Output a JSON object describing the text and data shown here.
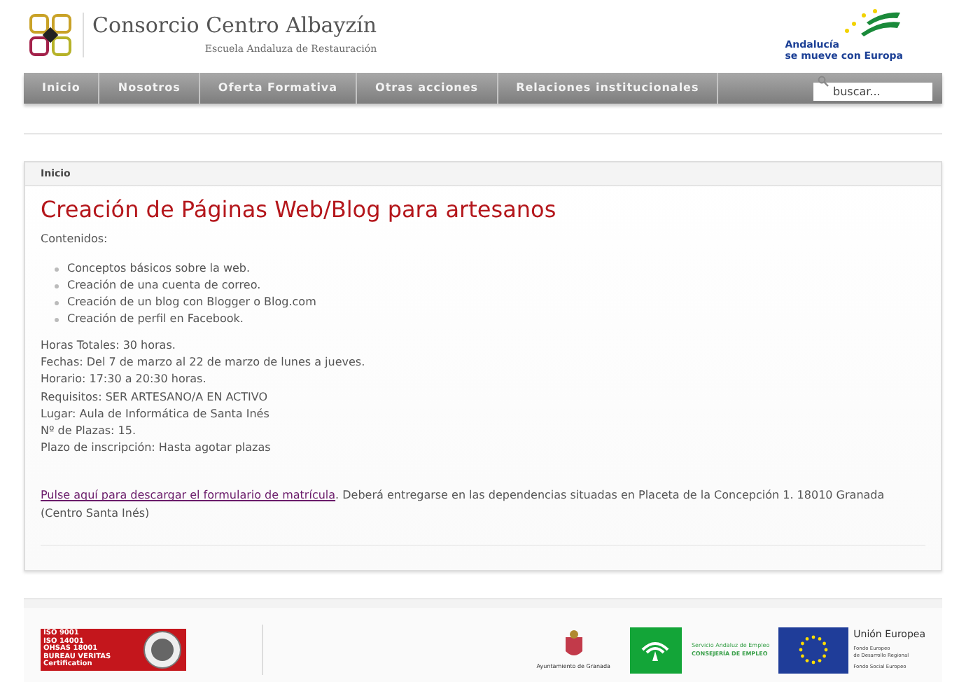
{
  "header": {
    "site_title": "Consorcio Centro Albayzín",
    "subtitle": "Escuela Andaluza de Restauración",
    "badge": {
      "line1": "Andalucía",
      "line2": "se mueve con Europa"
    }
  },
  "nav": {
    "items": [
      {
        "label": "Inicio"
      },
      {
        "label": "Nosotros"
      },
      {
        "label": "Oferta Formativa"
      },
      {
        "label": "Otras acciones"
      },
      {
        "label": "Relaciones institucionales"
      }
    ],
    "search": {
      "placeholder": "buscar..."
    }
  },
  "breadcrumb": "Inicio",
  "article": {
    "title": "Creación de Páginas Web/Blog para artesanos",
    "intro": "Contenidos:",
    "bullets": [
      "Conceptos básicos sobre la web.",
      "Creación de una cuenta de correo.",
      "Creación de un blog con Blogger o Blog.com",
      "Creación de perfil en Facebook."
    ],
    "details": [
      "Horas Totales: 30 horas.",
      "Fechas: Del 7 de marzo al 22 de marzo de lunes a jueves.",
      "Horario: 17:30 a 20:30 horas.",
      "Requisitos: SER ARTESANO/A EN ACTIVO",
      "Lugar: Aula de Informática de Santa Inés",
      "Nº de Plazas: 15.",
      "Plazo de inscripción: Hasta agotar plazas"
    ],
    "link": "Pulse aquí para descargar el formulario de matrícula",
    "after_link": ". Deberá entregarse en las dependencias situadas en Placeta de la Concepción 1. 18010 Granada (Centro Santa Inés)"
  },
  "footer": {
    "certification": [
      "ISO 9001",
      "ISO 14001",
      "OHSAS 18001",
      "BUREAU VERITAS",
      "Certification"
    ],
    "city": "Ayuntamiento de Granada",
    "employment": [
      "Servicio Andaluz de Empleo",
      "CONSEJERÍA DE EMPLEO"
    ],
    "eu": {
      "title": "Unión Europea",
      "line1": "Fondo Europeo",
      "line2": "de Desarrollo Regional",
      "line3": "Fondo Social Europeo"
    }
  }
}
